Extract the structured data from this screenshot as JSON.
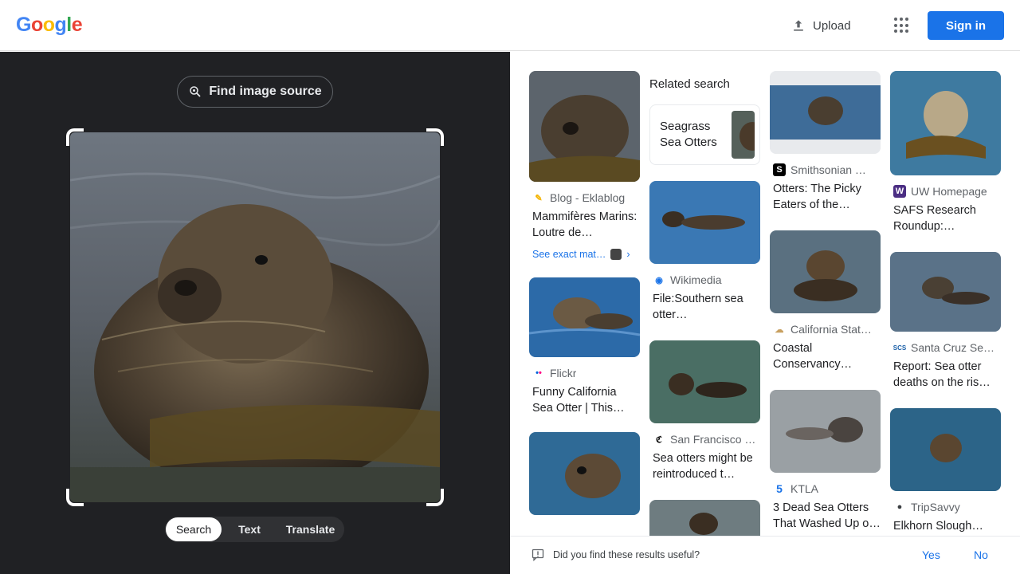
{
  "header": {
    "logo_letters": [
      {
        "char": "G",
        "color": "#4285f4"
      },
      {
        "char": "o",
        "color": "#ea4335"
      },
      {
        "char": "o",
        "color": "#fbbc05"
      },
      {
        "char": "g",
        "color": "#4285f4"
      },
      {
        "char": "l",
        "color": "#34a853"
      },
      {
        "char": "e",
        "color": "#ea4335"
      }
    ],
    "upload_label": "Upload",
    "apps_icon": "apps-grid-icon",
    "signin_label": "Sign in"
  },
  "left": {
    "find_source_label": "Find image source",
    "modes": [
      "Search",
      "Text",
      "Translate"
    ],
    "active_mode": "Search"
  },
  "related": {
    "heading": "Related search",
    "chip_label": "Seagrass Sea Otters"
  },
  "results": {
    "col1": [
      {
        "source": "Blog - Eklablog",
        "title": "Mammifères Marins: Loutre de…",
        "exact_match": "See exact mat…",
        "fav_color": "#f4b400",
        "fav_text": "✎"
      },
      {
        "source": "Flickr",
        "title": "Funny California Sea Otter | This…",
        "fav_color": "#ffffff",
        "fav_text": "••"
      },
      {
        "source": "",
        "title": ""
      }
    ],
    "col2": [
      {
        "source": "Wikimedia",
        "title": "File:Southern sea otter…",
        "fav_color": "#ffffff",
        "fav_text": "◉"
      },
      {
        "source": "San Francisco …",
        "title": "Sea otters might be reintroduced t…",
        "fav_color": "#ffffff",
        "fav_text": "ℭ"
      },
      {
        "source": "",
        "title": ""
      }
    ],
    "col3": [
      {
        "source": "Smithsonian …",
        "title": "Otters: The Picky Eaters of the…",
        "fav_color": "#000000",
        "fav_text": "S"
      },
      {
        "source": "California Stat…",
        "title": "Coastal Conservancy…",
        "fav_color": "#ffffff",
        "fav_text": "☁"
      },
      {
        "source": "KTLA",
        "title": "3 Dead Sea Otters That Washed Up o…",
        "fav_color": "#ffffff",
        "fav_text": "5"
      }
    ],
    "col4": [
      {
        "source": "UW Homepage",
        "title": "SAFS Research Roundup:…",
        "fav_color": "#4b2e83",
        "fav_text": "W"
      },
      {
        "source": "Santa Cruz Se…",
        "title": "Report: Sea otter deaths on the ris…",
        "fav_color": "#ffffff",
        "fav_text": "SCS"
      },
      {
        "source": "TripSavvy",
        "title": "Elkhorn Slough…",
        "fav_color": "#ffffff",
        "fav_text": "●"
      }
    ]
  },
  "feedback": {
    "question": "Did you find these results useful?",
    "yes": "Yes",
    "no": "No"
  },
  "colors": {
    "accent": "#1a73e8",
    "dark_bg": "#202124"
  }
}
